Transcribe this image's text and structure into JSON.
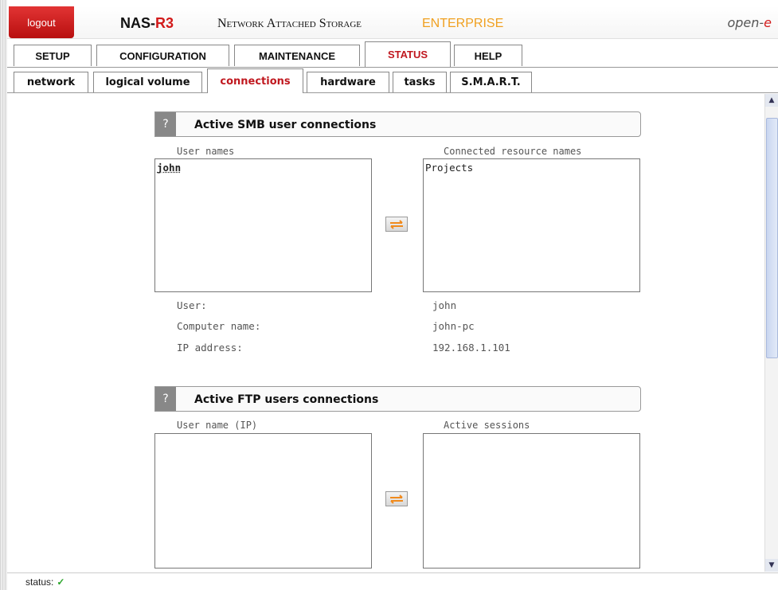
{
  "header": {
    "logout_label": "logout",
    "brand_prefix": "NAS-",
    "brand_suffix": "R3",
    "subtitle": "Network Attached Storage",
    "edition": "ENTERPRISE",
    "logo_prefix": "open-",
    "logo_suffix": "e"
  },
  "main_tabs": [
    {
      "label": "SETUP",
      "active": false
    },
    {
      "label": "CONFIGURATION",
      "active": false
    },
    {
      "label": "MAINTENANCE",
      "active": false
    },
    {
      "label": "STATUS",
      "active": true
    },
    {
      "label": "HELP",
      "active": false
    }
  ],
  "sub_tabs": [
    {
      "label": "network",
      "active": false
    },
    {
      "label": "logical volume",
      "active": false
    },
    {
      "label": "connections",
      "active": true
    },
    {
      "label": "hardware",
      "active": false
    },
    {
      "label": "tasks",
      "active": false
    },
    {
      "label": "S.M.A.R.T.",
      "active": false
    }
  ],
  "smb": {
    "help_icon": "?",
    "title": "Active SMB user connections",
    "left_label": "User names",
    "right_label": "Connected resource names",
    "users": [
      "john"
    ],
    "resources": [
      "Projects"
    ],
    "details": {
      "user_label": "User:",
      "user_value": "john",
      "computer_label": "Computer name:",
      "computer_value": "john-pc",
      "ip_label": "IP address:",
      "ip_value": "192.168.1.101"
    }
  },
  "ftp": {
    "help_icon": "?",
    "title": "Active FTP users connections",
    "left_label": "User name (IP)",
    "right_label": "Active sessions"
  },
  "status": {
    "label": "status:",
    "icon": "check-icon"
  },
  "colors": {
    "accent_red": "#c0181f",
    "edition_orange": "#f0a020",
    "ok_green": "#2aa52a"
  }
}
